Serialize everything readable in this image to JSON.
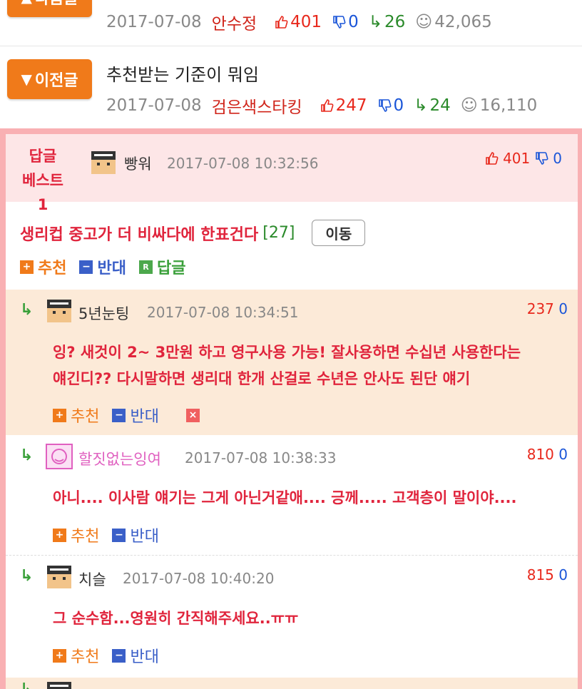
{
  "nav": {
    "next": {
      "button_label": "다음글",
      "date": "2017-07-08",
      "author": "안수정",
      "likes": "401",
      "dislikes": "0",
      "replies": "26",
      "views": "42,065"
    },
    "prev": {
      "button_label": "이전글",
      "title": "추천받는 기준이 뭐임",
      "date": "2017-07-08",
      "author": "검은색스타킹",
      "likes": "247",
      "dislikes": "0",
      "replies": "24",
      "views": "16,110"
    }
  },
  "best": {
    "label_line1": "답글",
    "label_line2": "베스트1",
    "nickname": "빵워",
    "time": "2017-07-08 10:32:56",
    "likes": "401",
    "dislikes": "0",
    "text": "생리컵 중고가 더 비싸다에 한표건다",
    "reply_count": "[27]",
    "move_label": "이동",
    "recommend_label": "추천",
    "oppose_label": "반대",
    "reply_label": "답글"
  },
  "replies": [
    {
      "nickname": "5년눈팅",
      "time": "2017-07-08 10:34:51",
      "likes": "237",
      "dislikes": "0",
      "line1": "잉? 새것이 2~ 3만원 하고 영구사용 가능! 잘사용하면 수십년 사용한다는",
      "line2": "얘긴디?? 다시말하면 생리대 한개 산걸로 수년은 안사도 된단 얘기",
      "recommend_label": "추천",
      "oppose_label": "반대"
    },
    {
      "nickname": "할짓없는잉여",
      "time": "2017-07-08 10:38:33",
      "likes": "810",
      "dislikes": "0",
      "line1": "아니.... 이사람 얘기는 그게 아닌거같애.... 긍께..... 고객층이 말이야....",
      "recommend_label": "추천",
      "oppose_label": "반대"
    },
    {
      "nickname": "치슬",
      "time": "2017-07-08 10:40:20",
      "likes": "815",
      "dislikes": "0",
      "line1": "그 순수함...영원히 간직해주세요..ㅠㅠ",
      "recommend_label": "추천",
      "oppose_label": "반대"
    }
  ],
  "icons": {
    "thumb_up": "thumbs-up-icon",
    "thumb_down": "thumbs-down-icon",
    "reply_arrow": "reply-arrow-icon",
    "views": "eye-icon"
  },
  "colors": {
    "accent_orange": "#f07a1a",
    "best_red": "#e0243c",
    "like_red": "#e8281c",
    "dislike_blue": "#1a55d8",
    "reply_green": "#2a8a2a"
  }
}
